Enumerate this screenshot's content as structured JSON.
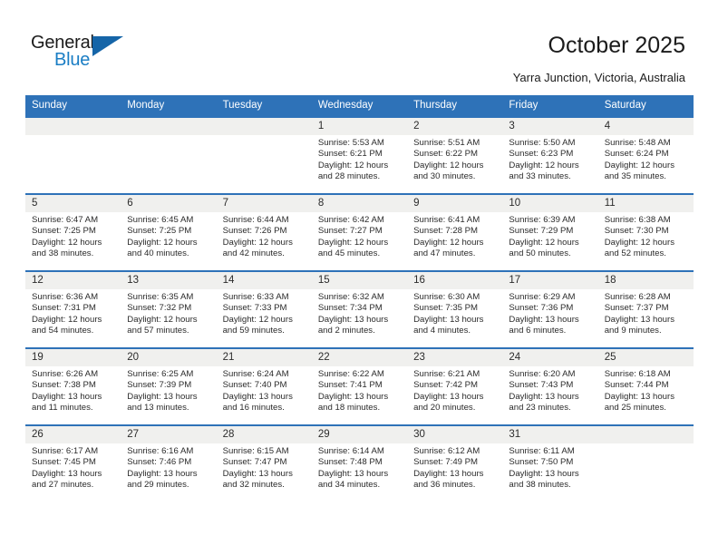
{
  "brand": {
    "name_top": "General",
    "name_bottom": "Blue",
    "color_dark": "#1b1b1b",
    "color_blue": "#1a7dc4",
    "triangle_color": "#1565a8"
  },
  "header": {
    "title": "October 2025",
    "subtitle": "Yarra Junction, Victoria, Australia",
    "accent_color": "#2e72b8",
    "band_color": "#f0f0ee"
  },
  "weekdays": [
    "Sunday",
    "Monday",
    "Tuesday",
    "Wednesday",
    "Thursday",
    "Friday",
    "Saturday"
  ],
  "weeks": [
    [
      {
        "day": "",
        "sunrise": "",
        "sunset": "",
        "daylight_line1": "",
        "daylight_line2": ""
      },
      {
        "day": "",
        "sunrise": "",
        "sunset": "",
        "daylight_line1": "",
        "daylight_line2": ""
      },
      {
        "day": "",
        "sunrise": "",
        "sunset": "",
        "daylight_line1": "",
        "daylight_line2": ""
      },
      {
        "day": "1",
        "sunrise": "Sunrise: 5:53 AM",
        "sunset": "Sunset: 6:21 PM",
        "daylight_line1": "Daylight: 12 hours",
        "daylight_line2": "and 28 minutes."
      },
      {
        "day": "2",
        "sunrise": "Sunrise: 5:51 AM",
        "sunset": "Sunset: 6:22 PM",
        "daylight_line1": "Daylight: 12 hours",
        "daylight_line2": "and 30 minutes."
      },
      {
        "day": "3",
        "sunrise": "Sunrise: 5:50 AM",
        "sunset": "Sunset: 6:23 PM",
        "daylight_line1": "Daylight: 12 hours",
        "daylight_line2": "and 33 minutes."
      },
      {
        "day": "4",
        "sunrise": "Sunrise: 5:48 AM",
        "sunset": "Sunset: 6:24 PM",
        "daylight_line1": "Daylight: 12 hours",
        "daylight_line2": "and 35 minutes."
      }
    ],
    [
      {
        "day": "5",
        "sunrise": "Sunrise: 6:47 AM",
        "sunset": "Sunset: 7:25 PM",
        "daylight_line1": "Daylight: 12 hours",
        "daylight_line2": "and 38 minutes."
      },
      {
        "day": "6",
        "sunrise": "Sunrise: 6:45 AM",
        "sunset": "Sunset: 7:25 PM",
        "daylight_line1": "Daylight: 12 hours",
        "daylight_line2": "and 40 minutes."
      },
      {
        "day": "7",
        "sunrise": "Sunrise: 6:44 AM",
        "sunset": "Sunset: 7:26 PM",
        "daylight_line1": "Daylight: 12 hours",
        "daylight_line2": "and 42 minutes."
      },
      {
        "day": "8",
        "sunrise": "Sunrise: 6:42 AM",
        "sunset": "Sunset: 7:27 PM",
        "daylight_line1": "Daylight: 12 hours",
        "daylight_line2": "and 45 minutes."
      },
      {
        "day": "9",
        "sunrise": "Sunrise: 6:41 AM",
        "sunset": "Sunset: 7:28 PM",
        "daylight_line1": "Daylight: 12 hours",
        "daylight_line2": "and 47 minutes."
      },
      {
        "day": "10",
        "sunrise": "Sunrise: 6:39 AM",
        "sunset": "Sunset: 7:29 PM",
        "daylight_line1": "Daylight: 12 hours",
        "daylight_line2": "and 50 minutes."
      },
      {
        "day": "11",
        "sunrise": "Sunrise: 6:38 AM",
        "sunset": "Sunset: 7:30 PM",
        "daylight_line1": "Daylight: 12 hours",
        "daylight_line2": "and 52 minutes."
      }
    ],
    [
      {
        "day": "12",
        "sunrise": "Sunrise: 6:36 AM",
        "sunset": "Sunset: 7:31 PM",
        "daylight_line1": "Daylight: 12 hours",
        "daylight_line2": "and 54 minutes."
      },
      {
        "day": "13",
        "sunrise": "Sunrise: 6:35 AM",
        "sunset": "Sunset: 7:32 PM",
        "daylight_line1": "Daylight: 12 hours",
        "daylight_line2": "and 57 minutes."
      },
      {
        "day": "14",
        "sunrise": "Sunrise: 6:33 AM",
        "sunset": "Sunset: 7:33 PM",
        "daylight_line1": "Daylight: 12 hours",
        "daylight_line2": "and 59 minutes."
      },
      {
        "day": "15",
        "sunrise": "Sunrise: 6:32 AM",
        "sunset": "Sunset: 7:34 PM",
        "daylight_line1": "Daylight: 13 hours",
        "daylight_line2": "and 2 minutes."
      },
      {
        "day": "16",
        "sunrise": "Sunrise: 6:30 AM",
        "sunset": "Sunset: 7:35 PM",
        "daylight_line1": "Daylight: 13 hours",
        "daylight_line2": "and 4 minutes."
      },
      {
        "day": "17",
        "sunrise": "Sunrise: 6:29 AM",
        "sunset": "Sunset: 7:36 PM",
        "daylight_line1": "Daylight: 13 hours",
        "daylight_line2": "and 6 minutes."
      },
      {
        "day": "18",
        "sunrise": "Sunrise: 6:28 AM",
        "sunset": "Sunset: 7:37 PM",
        "daylight_line1": "Daylight: 13 hours",
        "daylight_line2": "and 9 minutes."
      }
    ],
    [
      {
        "day": "19",
        "sunrise": "Sunrise: 6:26 AM",
        "sunset": "Sunset: 7:38 PM",
        "daylight_line1": "Daylight: 13 hours",
        "daylight_line2": "and 11 minutes."
      },
      {
        "day": "20",
        "sunrise": "Sunrise: 6:25 AM",
        "sunset": "Sunset: 7:39 PM",
        "daylight_line1": "Daylight: 13 hours",
        "daylight_line2": "and 13 minutes."
      },
      {
        "day": "21",
        "sunrise": "Sunrise: 6:24 AM",
        "sunset": "Sunset: 7:40 PM",
        "daylight_line1": "Daylight: 13 hours",
        "daylight_line2": "and 16 minutes."
      },
      {
        "day": "22",
        "sunrise": "Sunrise: 6:22 AM",
        "sunset": "Sunset: 7:41 PM",
        "daylight_line1": "Daylight: 13 hours",
        "daylight_line2": "and 18 minutes."
      },
      {
        "day": "23",
        "sunrise": "Sunrise: 6:21 AM",
        "sunset": "Sunset: 7:42 PM",
        "daylight_line1": "Daylight: 13 hours",
        "daylight_line2": "and 20 minutes."
      },
      {
        "day": "24",
        "sunrise": "Sunrise: 6:20 AM",
        "sunset": "Sunset: 7:43 PM",
        "daylight_line1": "Daylight: 13 hours",
        "daylight_line2": "and 23 minutes."
      },
      {
        "day": "25",
        "sunrise": "Sunrise: 6:18 AM",
        "sunset": "Sunset: 7:44 PM",
        "daylight_line1": "Daylight: 13 hours",
        "daylight_line2": "and 25 minutes."
      }
    ],
    [
      {
        "day": "26",
        "sunrise": "Sunrise: 6:17 AM",
        "sunset": "Sunset: 7:45 PM",
        "daylight_line1": "Daylight: 13 hours",
        "daylight_line2": "and 27 minutes."
      },
      {
        "day": "27",
        "sunrise": "Sunrise: 6:16 AM",
        "sunset": "Sunset: 7:46 PM",
        "daylight_line1": "Daylight: 13 hours",
        "daylight_line2": "and 29 minutes."
      },
      {
        "day": "28",
        "sunrise": "Sunrise: 6:15 AM",
        "sunset": "Sunset: 7:47 PM",
        "daylight_line1": "Daylight: 13 hours",
        "daylight_line2": "and 32 minutes."
      },
      {
        "day": "29",
        "sunrise": "Sunrise: 6:14 AM",
        "sunset": "Sunset: 7:48 PM",
        "daylight_line1": "Daylight: 13 hours",
        "daylight_line2": "and 34 minutes."
      },
      {
        "day": "30",
        "sunrise": "Sunrise: 6:12 AM",
        "sunset": "Sunset: 7:49 PM",
        "daylight_line1": "Daylight: 13 hours",
        "daylight_line2": "and 36 minutes."
      },
      {
        "day": "31",
        "sunrise": "Sunrise: 6:11 AM",
        "sunset": "Sunset: 7:50 PM",
        "daylight_line1": "Daylight: 13 hours",
        "daylight_line2": "and 38 minutes."
      },
      {
        "day": "",
        "sunrise": "",
        "sunset": "",
        "daylight_line1": "",
        "daylight_line2": ""
      }
    ]
  ]
}
